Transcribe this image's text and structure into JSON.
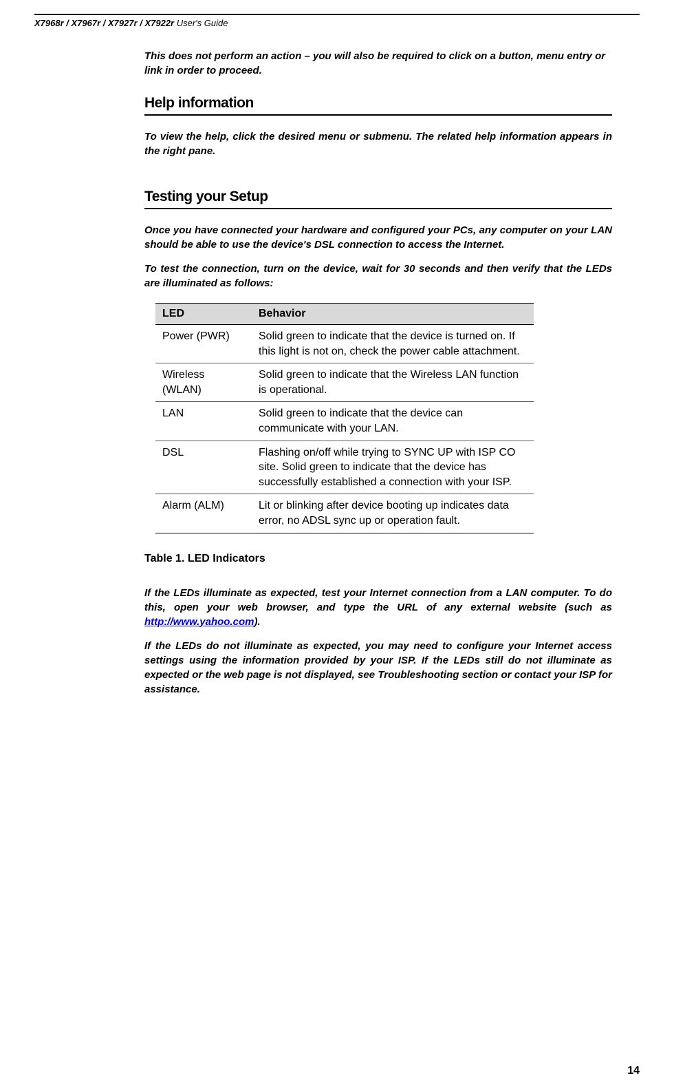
{
  "header": {
    "models": "X7968r / X7967r / X7927r / X7922r",
    "suffix": " User's Guide"
  },
  "intro_note": "This does not perform an action – you will also be required to click on a button, menu entry or link in order to proceed.",
  "sections": {
    "help": {
      "title": "Help information",
      "text": "To view the help, click the desired menu or submenu. The related help information appears in the right pane."
    },
    "testing": {
      "title": "Testing your Setup",
      "p1": "Once you have connected your hardware and configured your PCs, any computer on your LAN should be able to use the device's DSL connection to access the Internet.",
      "p2": "To test the connection, turn on the device, wait for 30 seconds and then verify that the LEDs are illuminated as follows:"
    }
  },
  "table": {
    "headers": {
      "c1": "LED",
      "c2": "Behavior"
    },
    "rows": [
      {
        "led": "Power (PWR)",
        "behavior": "Solid green to indicate that the device is turned on. If this light is not on, check the power cable attachment."
      },
      {
        "led": "Wireless (WLAN)",
        "behavior": "Solid green to indicate that the Wireless LAN function is operational."
      },
      {
        "led": "LAN",
        "behavior": "Solid green to indicate that the device can communicate with your LAN."
      },
      {
        "led": "DSL",
        "behavior": "Flashing on/off while trying to SYNC UP with ISP CO site.    Solid green to indicate that the device has successfully established a connection with your ISP."
      },
      {
        "led": "Alarm (ALM)",
        "behavior": "Lit or blinking after device booting up indicates data error, no ADSL sync up or operation fault."
      }
    ],
    "caption": "Table 1. LED Indicators"
  },
  "closing": {
    "p1a": "If the LEDs illuminate as expected, test your Internet connection from a LAN computer. To do this, open your web browser, and type the URL of any external website (such as ",
    "link_text": "http://www.yahoo.com",
    "link_href": "http://www.yahoo.com",
    "p1b": ").",
    "p2": "If the LEDs do not illuminate as expected, you may need to configure your Internet access settings using the information provided by your ISP. If the LEDs still do not illuminate as expected or the web page is not displayed, see Troubleshooting section or contact your ISP for assistance."
  },
  "page_number": "14"
}
